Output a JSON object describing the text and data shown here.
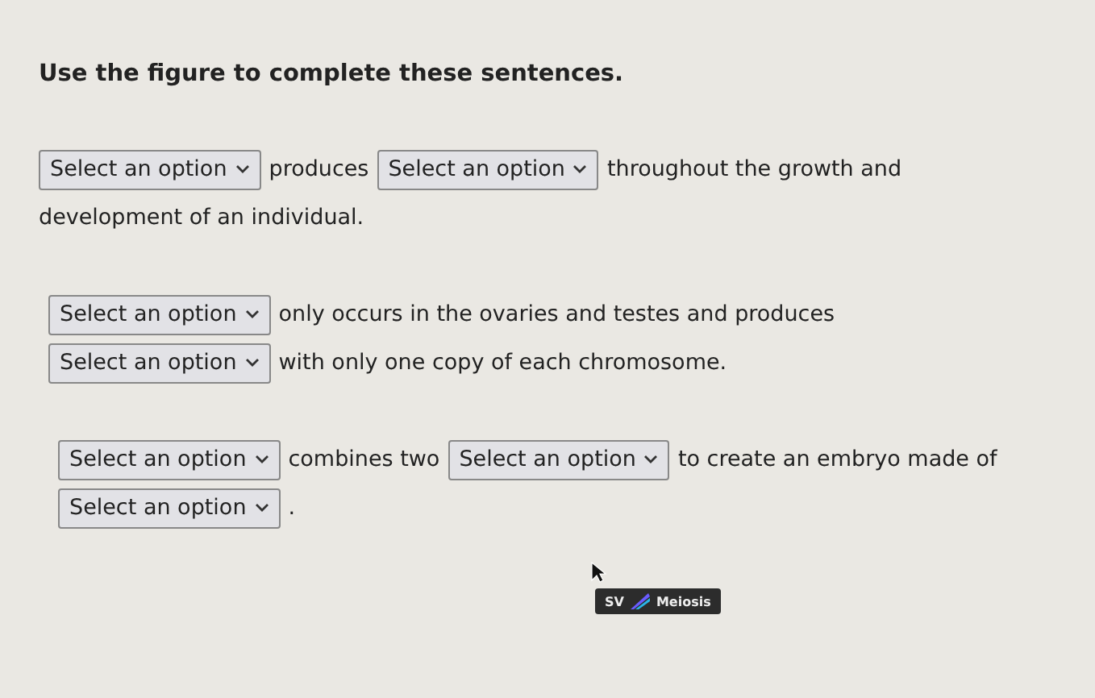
{
  "instruction": "Use the figure to complete these sentences.",
  "sentences": [
    {
      "lines": [
        [
          {
            "kind": "select",
            "placeholder": "Select an option"
          },
          {
            "kind": "text",
            "text": "produces"
          },
          {
            "kind": "select",
            "placeholder": "Select an option"
          },
          {
            "kind": "text",
            "text": "throughout the growth and"
          }
        ],
        [
          {
            "kind": "text",
            "text": "development of an individual."
          }
        ]
      ]
    },
    {
      "lines": [
        [
          {
            "kind": "select",
            "placeholder": "Select an option"
          },
          {
            "kind": "text",
            "text": "only occurs in the ovaries and testes and produces"
          }
        ],
        [
          {
            "kind": "select",
            "placeholder": "Select an option"
          },
          {
            "kind": "text",
            "text": "with only one copy of each chromosome."
          }
        ]
      ]
    },
    {
      "lines": [
        [
          {
            "kind": "select",
            "placeholder": "Select an option"
          },
          {
            "kind": "text",
            "text": "combines two"
          },
          {
            "kind": "select",
            "placeholder": "Select an option"
          },
          {
            "kind": "text",
            "text": "to create an embryo made of"
          }
        ],
        [
          {
            "kind": "select",
            "placeholder": "Select an option"
          },
          {
            "kind": "text",
            "text": "."
          }
        ]
      ]
    }
  ],
  "tooltip": {
    "prefix": "SV",
    "label": "Meiosis"
  }
}
